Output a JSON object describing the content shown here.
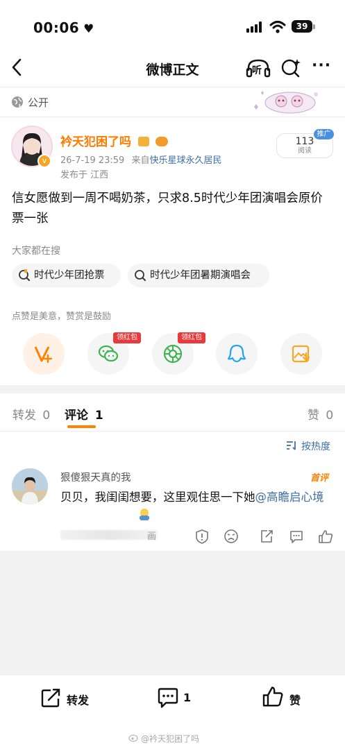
{
  "status_bar": {
    "time": "00:06",
    "battery": "39"
  },
  "nav": {
    "title": "微博正文",
    "listen_label": "听"
  },
  "visibility": {
    "label": "公开"
  },
  "post": {
    "author": "衿天犯困了吗",
    "timestamp": "26-7-19 23:59",
    "source_prefix": "来自",
    "source": "快乐星球永久居民",
    "location": "发布于 江西",
    "read_count": "113",
    "read_label": "阅读",
    "promo": "推广",
    "text": "信女愿做到一周不喝奶茶，只求8.5时代少年团演唱会原价票一张"
  },
  "search_section": {
    "hint": "大家都在搜",
    "chips": [
      {
        "label": "时代少年团抢票"
      },
      {
        "label": "时代少年团暑期演唱会"
      }
    ]
  },
  "reward": {
    "hint": "点赞是美意，赞赏是鼓励",
    "hongbao_label": "领红包"
  },
  "tabs": [
    {
      "label": "转发",
      "count": "0"
    },
    {
      "label": "评论",
      "count": "1"
    },
    {
      "label": "赞",
      "count": "0"
    }
  ],
  "sort": {
    "label": "按热度"
  },
  "comment": {
    "author": "狠傻狠天真的我",
    "badge": "首评",
    "text_main": "贝贝，我闺闺想要，这里观住思一下她",
    "mention": "@高瞻启心境",
    "meta_tail": "画"
  },
  "bottom_bar": {
    "repost": "转发",
    "comment_count": "1",
    "like": "赞"
  },
  "watermark": "@衿天犯困了吗",
  "colors": {
    "accent": "#ff8200",
    "link": "#3f6fa8",
    "username": "#ff7a00",
    "hongbao": "#e83a3a"
  }
}
